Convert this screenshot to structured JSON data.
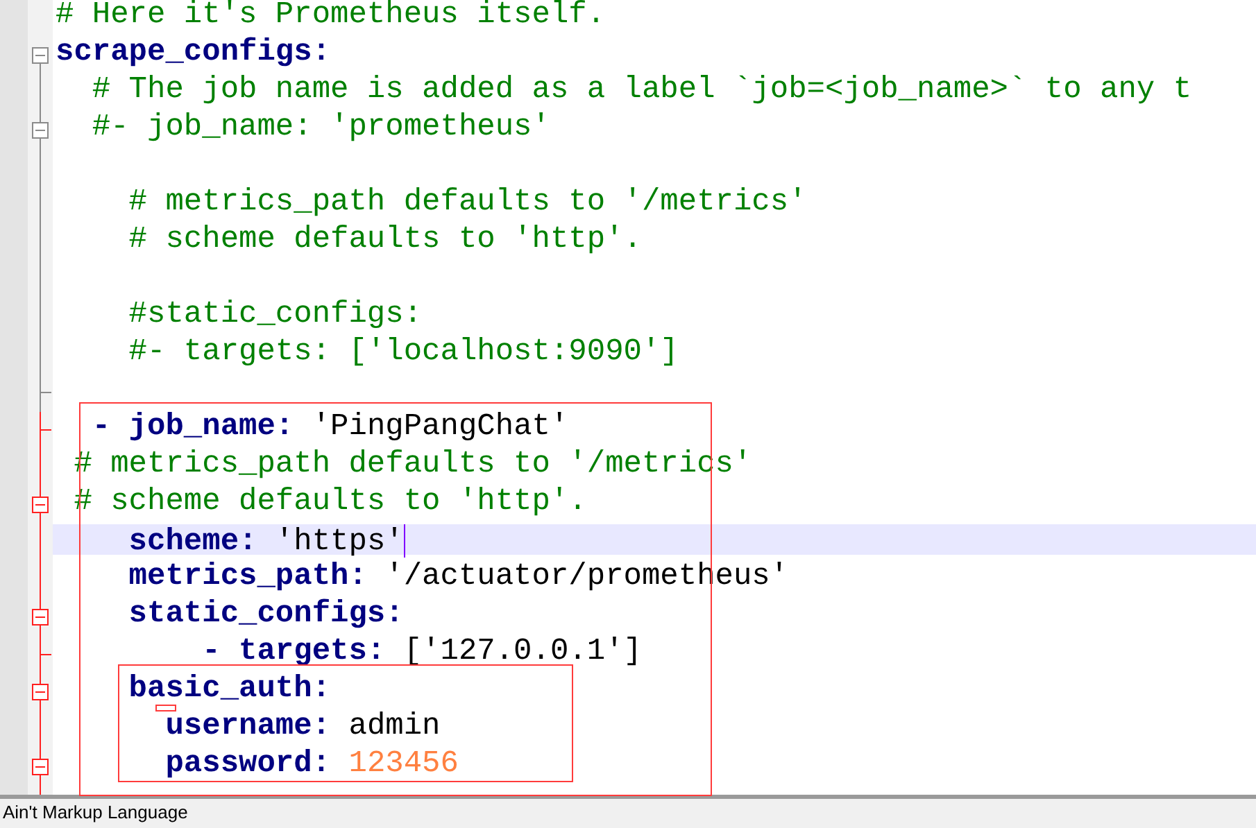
{
  "editor": {
    "lines": [
      {
        "current": false,
        "segments": [
          {
            "kind": "comment",
            "text": "# Here it's Prometheus itself."
          }
        ]
      },
      {
        "current": false,
        "segments": [
          {
            "kind": "key",
            "text": "scrape_configs:"
          }
        ]
      },
      {
        "current": false,
        "segments": [
          {
            "kind": "comment",
            "text": "  # The job name is added as a label `job=<job_name>` to any t"
          }
        ]
      },
      {
        "current": false,
        "segments": [
          {
            "kind": "comment",
            "text": "  #- job_name: 'prometheus'"
          }
        ]
      },
      {
        "current": false
      },
      {
        "current": false,
        "segments": [
          {
            "kind": "comment",
            "text": "    # metrics_path defaults to '/metrics'"
          }
        ]
      },
      {
        "current": false,
        "segments": [
          {
            "kind": "comment",
            "text": "    # scheme defaults to 'http'."
          }
        ]
      },
      {
        "current": false
      },
      {
        "current": false,
        "segments": [
          {
            "kind": "comment",
            "text": "    #static_configs:"
          }
        ]
      },
      {
        "current": false,
        "segments": [
          {
            "kind": "comment",
            "text": "    #- targets: ['localhost:9090']"
          }
        ]
      },
      {
        "current": false
      },
      {
        "current": false,
        "segments": [
          {
            "kind": "key",
            "text": "  - job_name:"
          },
          {
            "kind": "text",
            "text": " 'PingPangChat'"
          }
        ]
      },
      {
        "current": false,
        "segments": [
          {
            "kind": "comment",
            "text": " # metrics_path defaults to '/metrics'"
          }
        ]
      },
      {
        "current": false,
        "segments": [
          {
            "kind": "comment",
            "text": " # scheme defaults to 'http'."
          }
        ]
      },
      {
        "current": true,
        "segments": [
          {
            "kind": "key",
            "text": "    scheme:"
          },
          {
            "kind": "text",
            "text": " 'https'"
          }
        ]
      },
      {
        "current": false,
        "segments": [
          {
            "kind": "key",
            "text": "    metrics_path:"
          },
          {
            "kind": "text",
            "text": " '/actuator/prometheus'"
          }
        ]
      },
      {
        "current": false,
        "segments": [
          {
            "kind": "key",
            "text": "    static_configs:"
          }
        ]
      },
      {
        "current": false,
        "segments": [
          {
            "kind": "key",
            "text": "        - targets:"
          },
          {
            "kind": "text",
            "text": " ['127.0.0.1']"
          }
        ]
      },
      {
        "current": false,
        "segments": [
          {
            "kind": "key",
            "text": "    basic_auth:"
          }
        ]
      },
      {
        "current": false,
        "segments": [
          {
            "kind": "key",
            "text": "      username:"
          },
          {
            "kind": "text",
            "text": " admin"
          }
        ]
      },
      {
        "current": false,
        "segments": [
          {
            "kind": "key",
            "text": "      password:"
          },
          {
            "kind": "number",
            "text": " 123456"
          }
        ]
      }
    ]
  },
  "status_bar": {
    "text": "Ain't Markup Language"
  }
}
